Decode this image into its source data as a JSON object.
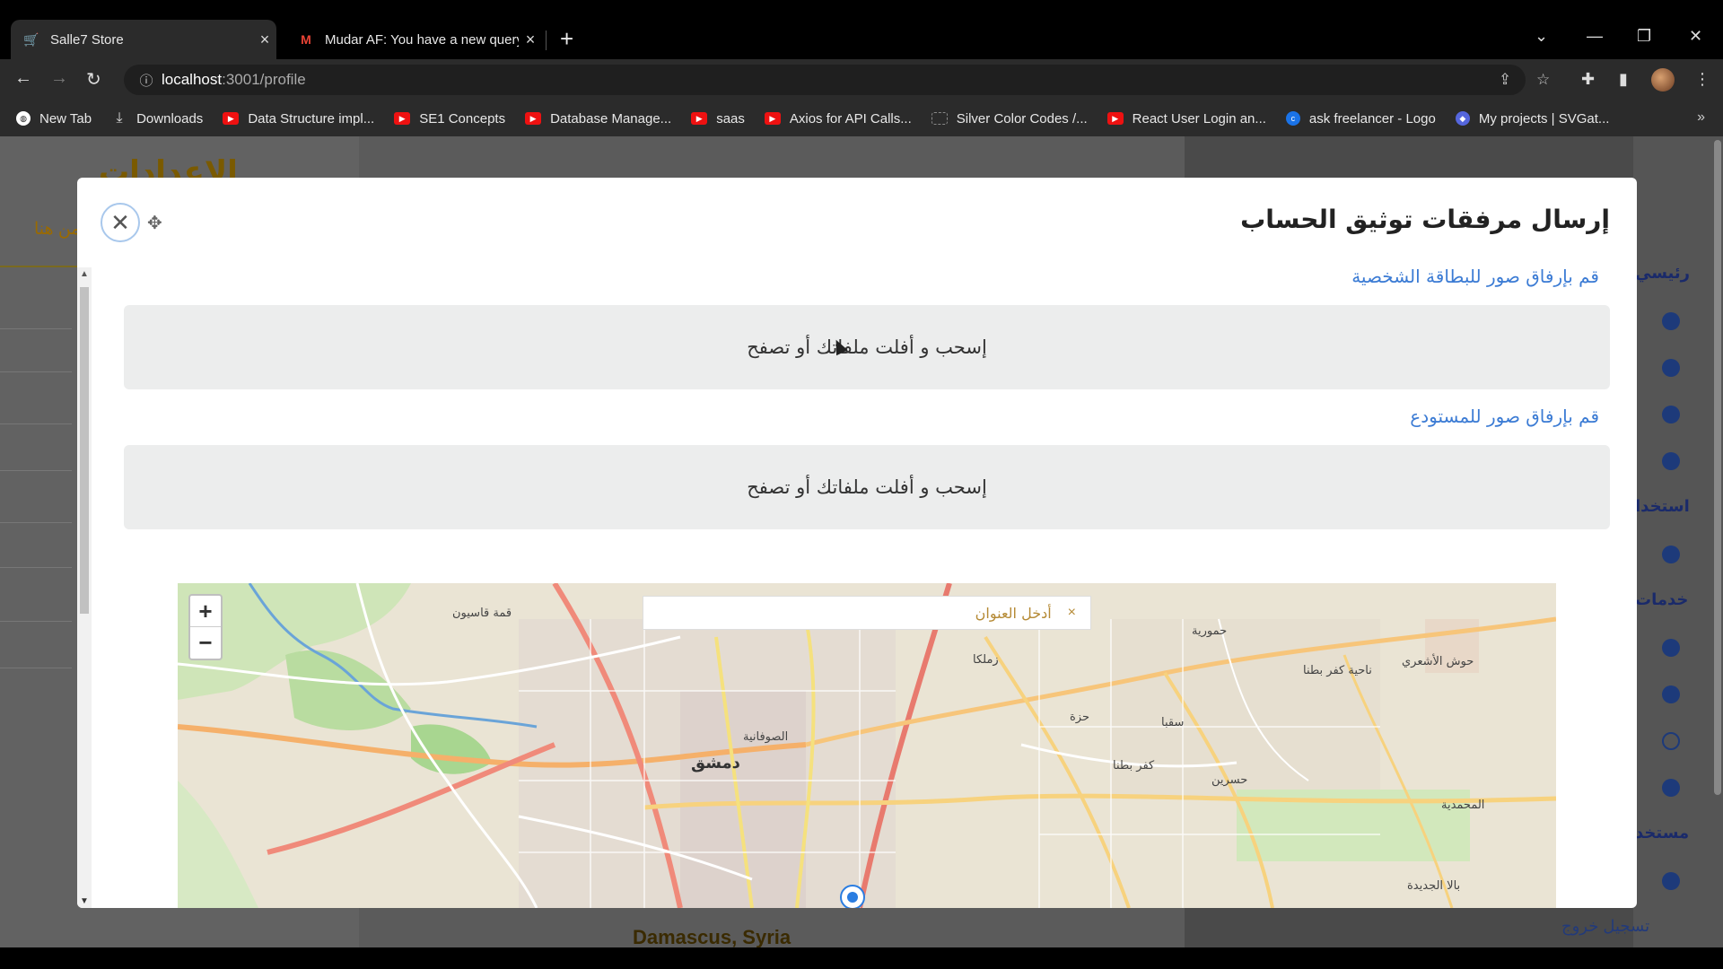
{
  "browser": {
    "tabs": [
      {
        "title": "Salle7 Store",
        "active": true,
        "icon": "store-favicon"
      },
      {
        "title": "Mudar AF: You have a new query",
        "active": false,
        "icon": "gmail-icon"
      }
    ],
    "address": {
      "host": "localhost",
      "path": ":3001/profile"
    },
    "bookmarks": [
      {
        "label": "New Tab",
        "icon": "globe-icon"
      },
      {
        "label": "Downloads",
        "icon": "download-icon"
      },
      {
        "label": "Data Structure impl...",
        "icon": "youtube-icon"
      },
      {
        "label": "SE1 Concepts",
        "icon": "youtube-icon"
      },
      {
        "label": "Database Manage...",
        "icon": "youtube-icon"
      },
      {
        "label": "saas",
        "icon": "youtube-icon"
      },
      {
        "label": "Axios for API Calls...",
        "icon": "youtube-icon"
      },
      {
        "label": "Silver Color Codes /...",
        "icon": "grid-icon"
      },
      {
        "label": "React User Login an...",
        "icon": "youtube-icon"
      },
      {
        "label": "ask freelancer - Logo",
        "icon": "c-icon"
      },
      {
        "label": "My projects | SVGat...",
        "icon": "svgator-icon"
      }
    ]
  },
  "background": {
    "settings_title": "الإعدادات",
    "link_text": "من هنا",
    "sidebar": {
      "main": "رئيسي",
      "usage": "استخدا",
      "services": "خدمات",
      "users": "مستخد"
    },
    "location": "Damascus, Syria",
    "logout": "تسجيل خروج"
  },
  "modal": {
    "title": "إرسال مرفقات توثيق الحساب",
    "id_card_label": "قم بإرفاق صور للبطاقة الشخصية",
    "warehouse_label": "قم بإرفاق صور للمستودع",
    "dropzone_text": "إسحب و أفلت ملفاتك أو تصفح",
    "map": {
      "search_placeholder": "أدخل العنوان",
      "clear": "×",
      "zoom_in": "+",
      "zoom_out": "−",
      "labels": {
        "damascus": "دمشق",
        "sufaniye": "الصوفانية",
        "zamalka": "زملكا",
        "saqba": "سقبا",
        "kafr_batna": "كفر بطنا",
        "hammouriyeh": "حمورية",
        "hawsh": "حوش الأشعري",
        "mohammadiyeh": "المحمدية",
        "hazza": "حزة",
        "hosh": "حسرين",
        "kafr": "ناحية كفر بطنا",
        "qasyoun": "قمة قاسيون",
        "bala": "بالا الجديدة"
      }
    }
  }
}
